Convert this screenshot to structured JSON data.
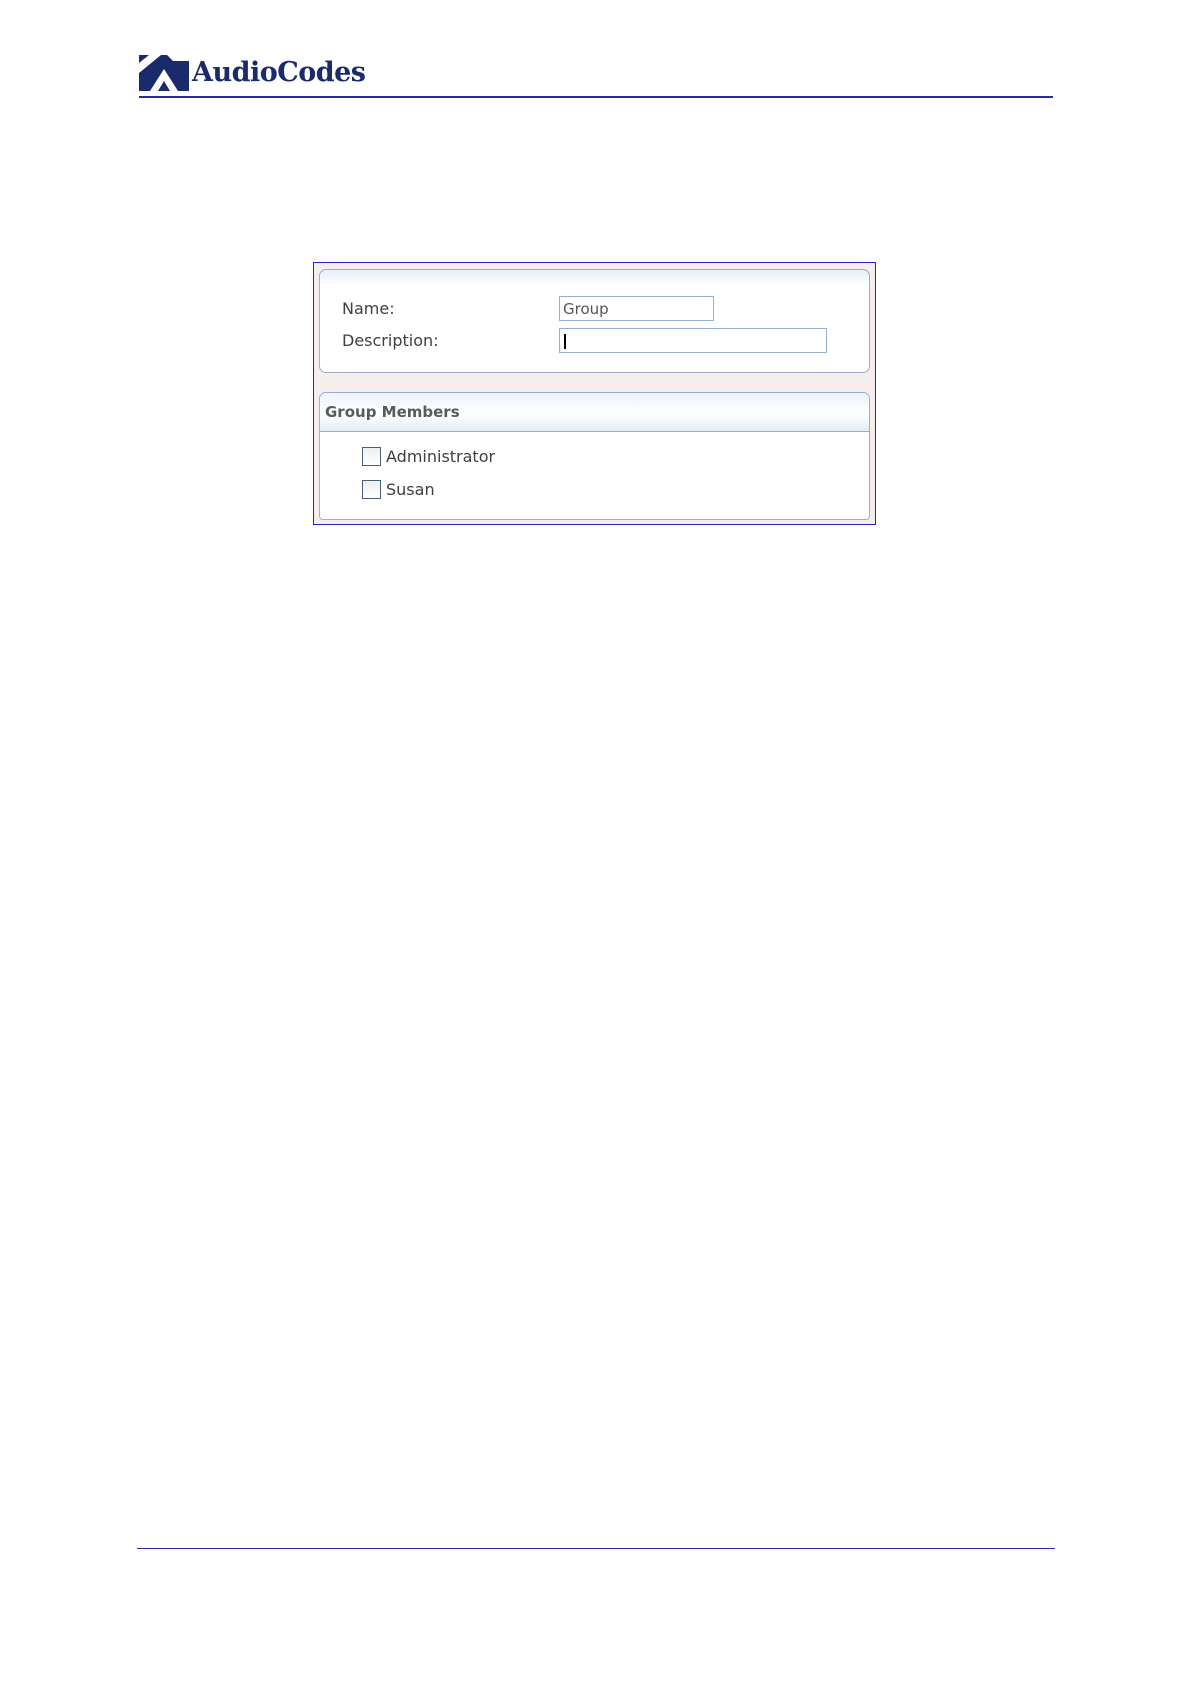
{
  "header": {
    "brand_name": "AudioCodes",
    "logo_icon": "audiocodes-logo-icon",
    "brand_color": "#1b2a6b",
    "rule_color": "#2a2a9e"
  },
  "form": {
    "name_label": "Name:",
    "name_value": "Group",
    "description_label": "Description:",
    "description_value": ""
  },
  "group_members": {
    "title": "Group Members",
    "members": [
      {
        "label": "Administrator",
        "checked": false
      },
      {
        "label": "Susan",
        "checked": false
      }
    ]
  }
}
